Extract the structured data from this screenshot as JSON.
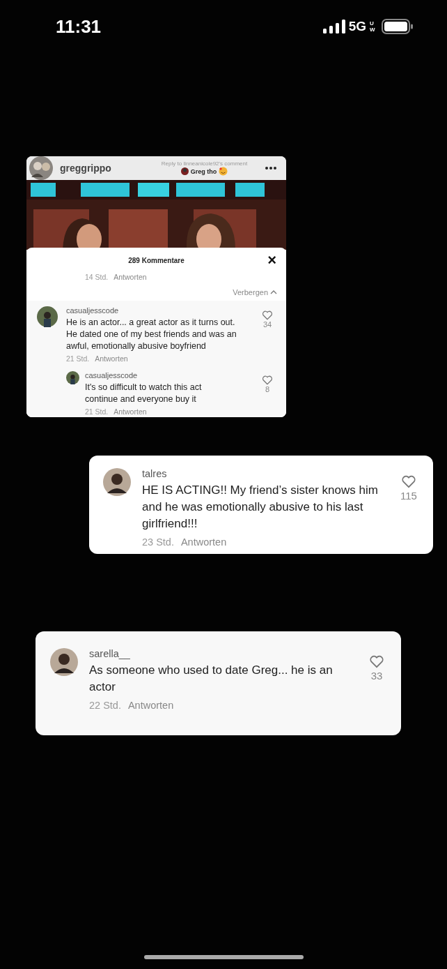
{
  "status_bar": {
    "time": "11:31",
    "network": "5G",
    "network_suffix": "UW"
  },
  "post_card": {
    "username": "greggrippo",
    "reply_to": "Reply to linneanicole92's comment",
    "reply_text": "Greg tho",
    "comments_panel": {
      "title": "289 Kommentare",
      "close": "×",
      "prev_time": "14 Std.",
      "prev_reply": "Antworten",
      "collapse": "Verbergen",
      "comments": [
        {
          "username": "casualjesscode",
          "text": "He is an actor... a great actor as it turns out. He dated one of my best friends and was an awful, emotionally abusive boyfriend",
          "likes": "34",
          "time": "21 Std.",
          "reply": "Antworten",
          "replies": [
            {
              "username": "casualjesscode",
              "text": "It's so difficult to watch this act continue and everyone buy it",
              "likes": "8",
              "time": "21 Std.",
              "reply": "Antworten"
            }
          ]
        }
      ]
    }
  },
  "comment_cards": [
    {
      "username": "talres",
      "text": "HE IS ACTING!! My friend’s sister knows him and he was emotionally abusive to his last girlfriend!!!",
      "likes": "115",
      "time": "23 Std.",
      "reply": "Antworten"
    },
    {
      "username": "sarella__",
      "text": "As someone who used to date Greg... he is an actor",
      "likes": "33",
      "time": "22 Std.",
      "reply": "Antworten"
    }
  ]
}
